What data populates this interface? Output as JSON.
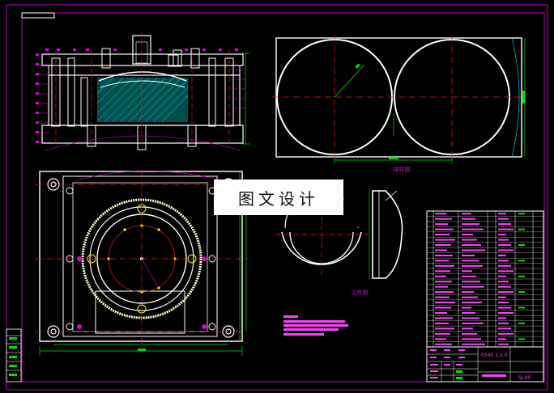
{
  "watermark": "图文设计",
  "colors": {
    "background": "#000000",
    "border": "#c000c0",
    "outline": "#ffffff",
    "center_line": "#e02020",
    "dimension": "#00e000",
    "hatch": "#00c8c8",
    "annotation": "#e000e0",
    "accent": "#ffff00",
    "table_text": "#ff40ff"
  },
  "labels": {
    "layout_view": "排样图",
    "part_view": "工件图"
  },
  "title_block": {
    "scale": "0545 1:2.0",
    "drawing_number": "SJ-00"
  }
}
